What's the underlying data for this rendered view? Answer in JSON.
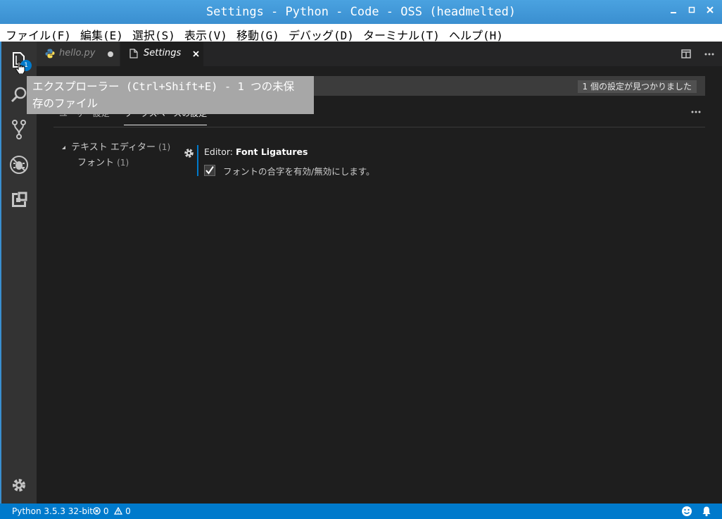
{
  "window": {
    "title": "Settings - Python - Code - OSS (headmelted)"
  },
  "menu": [
    "ファイル(F)",
    "編集(E)",
    "選択(S)",
    "表示(V)",
    "移動(G)",
    "デバッグ(D)",
    "ターミナル(T)",
    "ヘルプ(H)"
  ],
  "activity": {
    "explorer_badge": "1"
  },
  "tabs": [
    {
      "label": "hello.py",
      "modified": true,
      "icon": "python-icon"
    },
    {
      "label": "Settings",
      "active": true,
      "icon": "file-icon"
    }
  ],
  "settings": {
    "count_label": "1 個の設定が見つかりました",
    "user_tab": "ユーザー設定",
    "workspace_tab": "ワークスペースの設定",
    "tree": [
      {
        "label": "テキスト エディター",
        "count": "(1)"
      },
      {
        "label": "フォント",
        "count": "(1)"
      }
    ],
    "item": {
      "category": "Editor: ",
      "name": "Font Ligatures",
      "description": "フォントの合字を有効/無効にします。",
      "checked": true
    }
  },
  "tooltip": {
    "line1": "エクスプローラー (Ctrl+Shift+E) - 1 つの未保",
    "line2": "存のファイル"
  },
  "status": {
    "interpreter": "Python 3.5.3 32-bit",
    "errors": "0",
    "warnings": "0"
  },
  "colors": {
    "accent": "#007acc",
    "titlebar": "#3a8fd0",
    "background": "#1e1e1e"
  }
}
